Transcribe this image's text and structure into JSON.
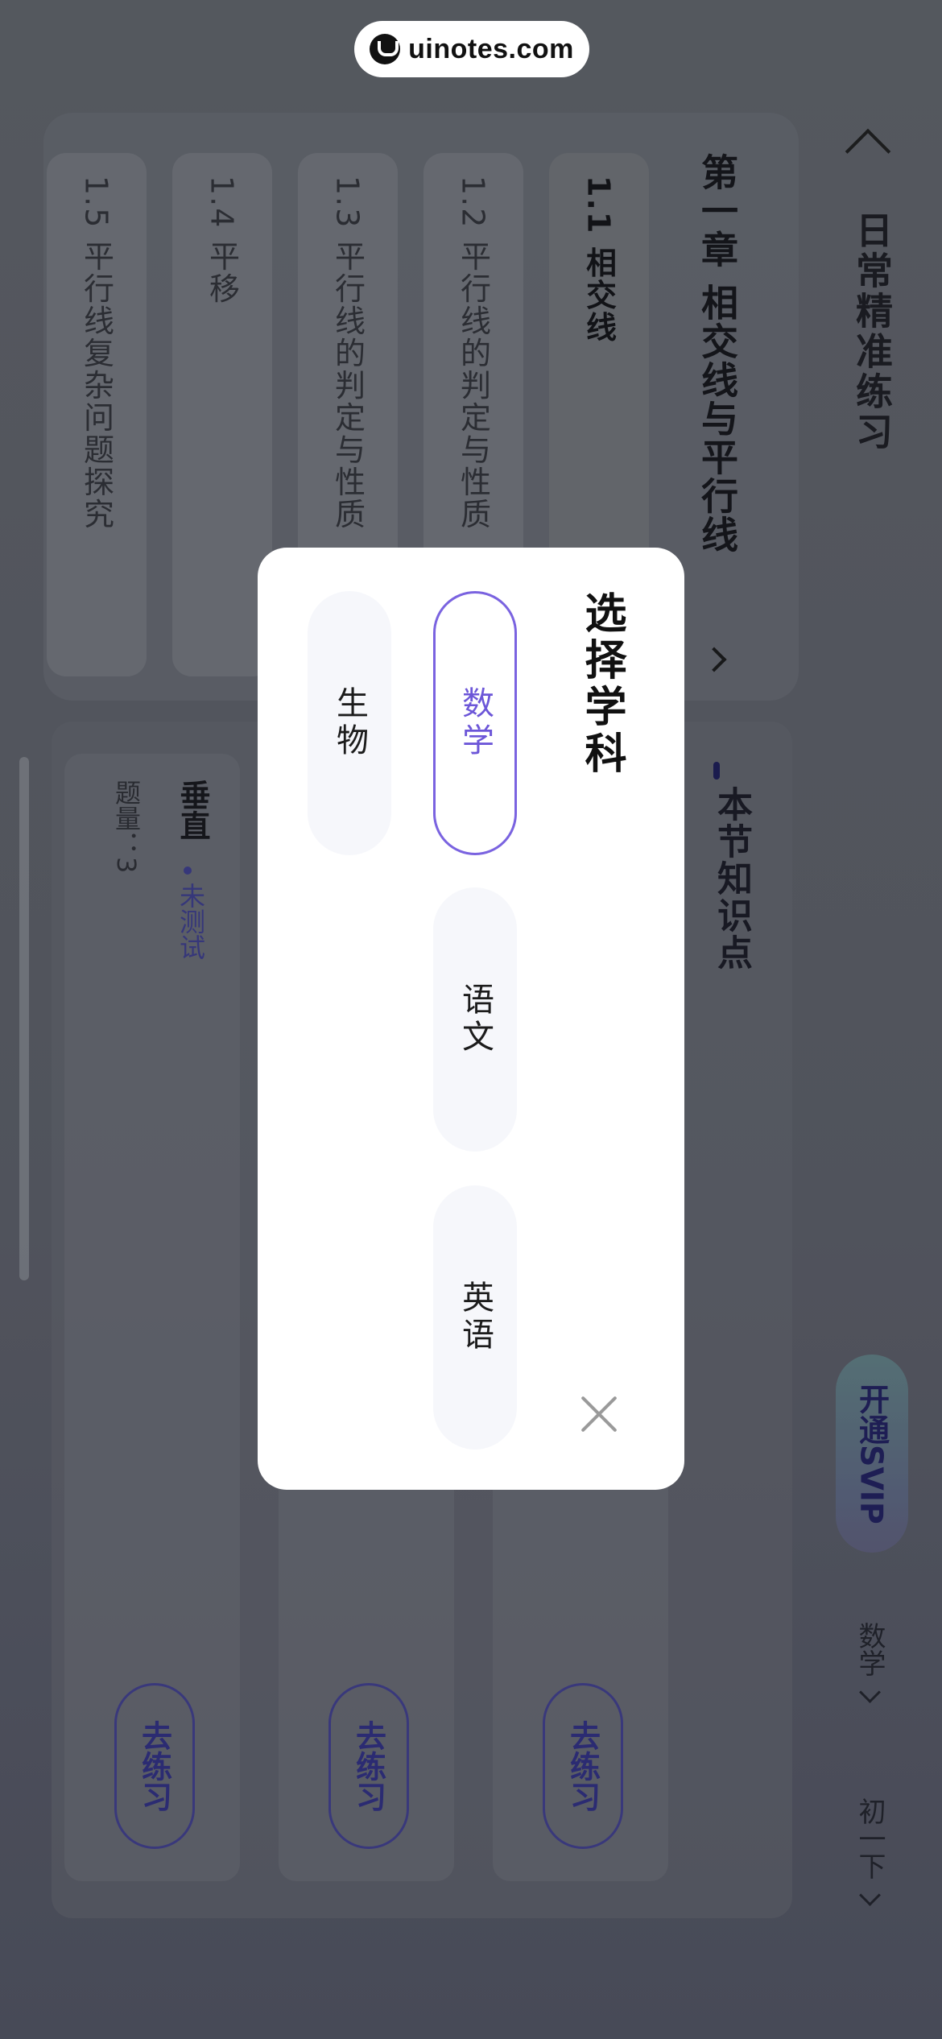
{
  "watermark": {
    "text": "uinotes.com"
  },
  "header": {
    "title": "日常精准练习",
    "svip_label": "开通SVIP",
    "subject_filter": "数学",
    "grade_filter": "初一下"
  },
  "chapter": {
    "title": "第一章 相交线与平行线",
    "sections": [
      {
        "label": "1.1 相交线",
        "active": true
      },
      {
        "label": "1.2 平行线的判定与性质"
      },
      {
        "label": "1.3 平行线的判定与性质"
      },
      {
        "label": "1.4 平移"
      },
      {
        "label": "1.5 平行线复杂问题探究"
      }
    ]
  },
  "knowledge": {
    "title": "本节知识点",
    "cards": [
      {
        "name": "垂直",
        "status": "未测试",
        "count": "题量：3",
        "action": "去练习"
      },
      {
        "action": "去练习"
      },
      {
        "action": "去练习"
      }
    ]
  },
  "modal": {
    "title": "选择学科",
    "subjects": [
      "数学",
      "语文",
      "英语",
      "生物"
    ],
    "selected": "数学"
  },
  "colors": {
    "accent": "#7a63e0",
    "svip_text": "#1d1b5c",
    "overlay": "#5d6068"
  }
}
